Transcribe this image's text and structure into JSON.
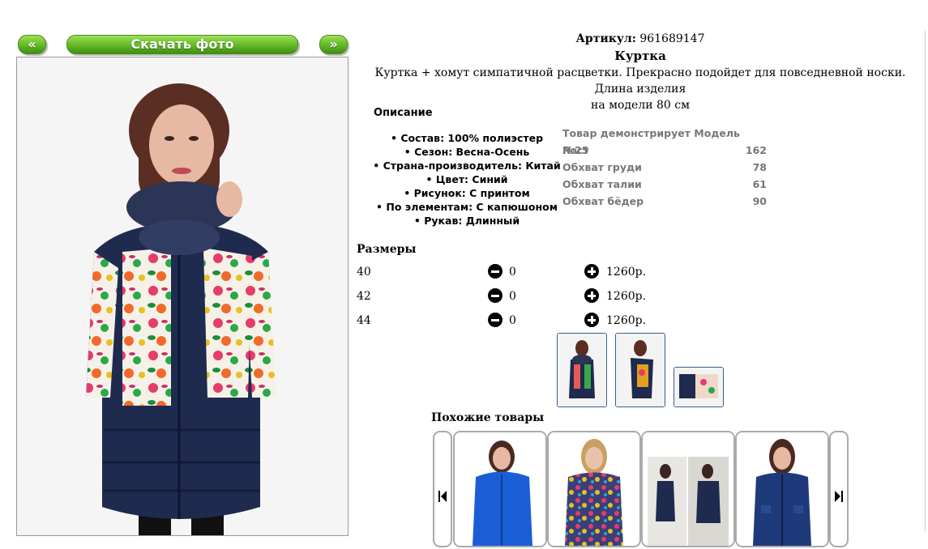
{
  "nav": {
    "prev_label": "«",
    "download_label": "Скачать фото",
    "next_label": "»"
  },
  "product": {
    "article_label": "Артикул:",
    "article_value": "961689147",
    "name": "Куртка",
    "description_line1": "Куртка + хомут симпатичной расцветки. Прекрасно подойдет для повседневной носки. Длина изделия",
    "description_line2": "на модели 80 см"
  },
  "specs": {
    "heading": "Описание",
    "items": [
      "Состав: 100% полиэстер",
      "Сезон: Весна-Осень",
      "Страна-производитель: Китай",
      "Цвет: Синий",
      "Рисунок: С принтом",
      "По элементам: С капюшоном",
      "Рукав: Длинный"
    ]
  },
  "model": {
    "title": "Товар демонстрирует Модель №25",
    "rows": [
      {
        "label": "Рост",
        "value": "162"
      },
      {
        "label": "Обхват груди",
        "value": "78"
      },
      {
        "label": "Обхват талии",
        "value": "61"
      },
      {
        "label": "Обхват бёдер",
        "value": "90"
      }
    ]
  },
  "sizes": {
    "heading": "Размеры",
    "rows": [
      {
        "size": "40",
        "qty": "0",
        "price": "1260р."
      },
      {
        "size": "42",
        "qty": "0",
        "price": "1260р."
      },
      {
        "size": "44",
        "qty": "0",
        "price": "1260р."
      }
    ]
  },
  "similar": {
    "heading": "Похожие товары"
  },
  "colors": {
    "accent_green": "#6cbf2c",
    "jacket_navy": "#1f2a4f",
    "thumb_border": "#3b5d8a"
  },
  "icons": [
    "prev-icon",
    "next-icon",
    "minus-icon",
    "plus-icon",
    "skip-prev-icon",
    "skip-next-icon"
  ]
}
